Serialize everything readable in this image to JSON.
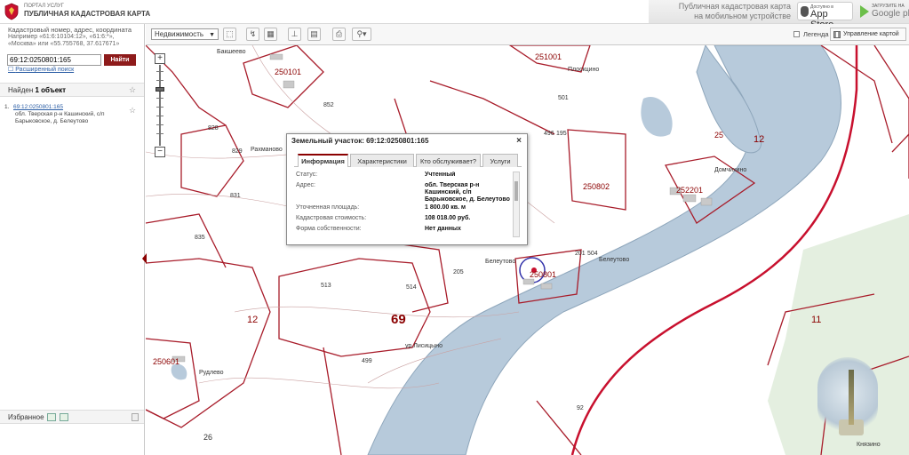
{
  "header": {
    "portal_small": "ПОРТАЛ УСЛУГ",
    "portal_big": "ПУБЛИЧНАЯ КАДАСТРОВАЯ КАРТА",
    "mobile_line1": "Публичная кадастровая карта",
    "mobile_line2": "на мобильном устройстве",
    "appstore_small": "Доступно в",
    "appstore_big": "App Store",
    "gplay_small": "ЗАГРУЗИТЕ НА",
    "gplay_big": "Google play"
  },
  "search": {
    "hint_line1": "Кадастровый номер, адрес, координата",
    "hint_line2": "Например «61:6:10104:12», «61:6:*»,",
    "hint_line3": "«Москва» или «55.755768, 37.617671»",
    "value": "69:12:0250801:165",
    "find_label": "Найти",
    "advanced_label": "Расширенный поиск"
  },
  "results": {
    "found_prefix": "Найден",
    "found_count": "1 объект",
    "item_num": "1.",
    "item_link": "69:12:0250801:165",
    "item_addr1": "обл. Тверская р-н Кашинский, с/п",
    "item_addr2": "Барыковское, д. Белеутово"
  },
  "favorites": {
    "label": "Избранное"
  },
  "toolbar": {
    "select_value": "Недвижимость",
    "legend_label": "Легенда",
    "layers_label": "Управление картой"
  },
  "popup": {
    "title": "Земельный участок: 69:12:0250801:165",
    "tabs": [
      "Информация",
      "Характеристики",
      "Кто обслуживает?",
      "Услуги"
    ],
    "rows": [
      {
        "key": "Статус:",
        "value": "Учтенный"
      },
      {
        "key": "Адрес:",
        "value": "обл. Тверская р-н Кашинский, с/п Барыковское, д. Белеутово"
      },
      {
        "key": "Уточненная площадь:",
        "value": "1 800.00 кв. м"
      },
      {
        "key": "Кадастровая стоимость:",
        "value": "108 018.00 руб."
      },
      {
        "key": "Форма собственности:",
        "value": "Нет данных"
      }
    ]
  },
  "map": {
    "places": {
      "bakshevo": "Бакшеево",
      "rakhmanovo": "Рахманово",
      "beleutovo1": "Белеутово",
      "beleutovo2": "Белеутово",
      "domchikhino": "Домчихино",
      "lisitsyno": "ур.Лисицыно",
      "rudlevo": "Рудлево",
      "knyazhino": "Князино",
      "dmitrovka": "Плоскцино"
    },
    "parcels": {
      "p250101": "250101",
      "p251001": "251001",
      "p250802": "250802",
      "p252201": "252201",
      "p250801": "250801",
      "p250601": "250601",
      "p852": "852",
      "p828": "828",
      "p829": "829",
      "p831": "831",
      "p835": "835",
      "p513": "513",
      "p514": "514",
      "p205": "205",
      "p201": "201",
      "p504": "504",
      "p499": "499",
      "p92": "92",
      "p26": "26",
      "p25": "25",
      "p496": "496",
      "p195": "195",
      "p501": "501"
    },
    "districts": {
      "d12a": "12",
      "d12b": "12",
      "d11": "11"
    },
    "region": "69"
  }
}
